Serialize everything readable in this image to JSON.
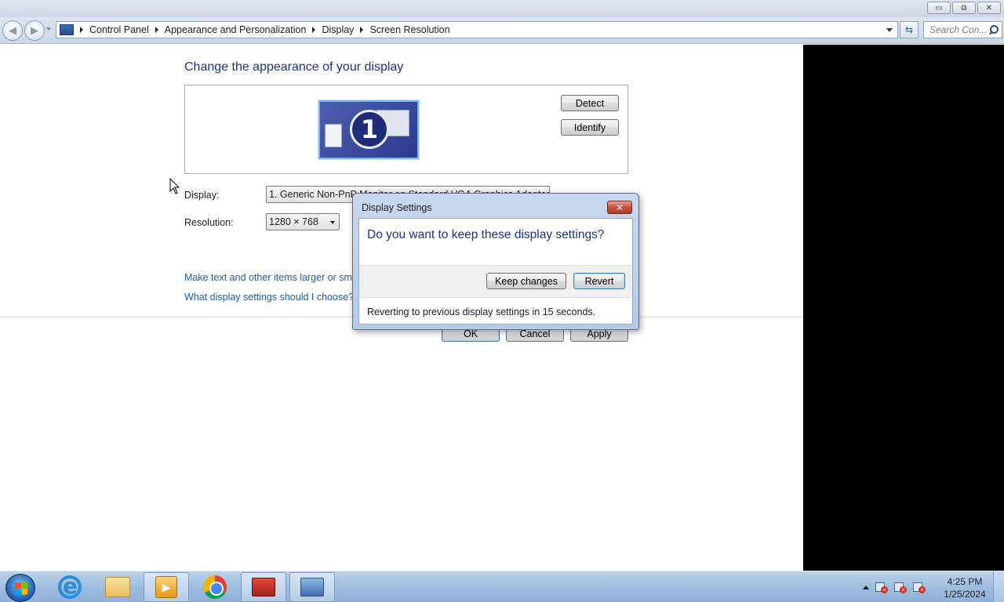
{
  "window": {
    "controls": {
      "minimize": "▭",
      "maximize": "⧉",
      "close": "✕"
    }
  },
  "address": {
    "breadcrumbs": [
      "Control Panel",
      "Appearance and Personalization",
      "Display",
      "Screen Resolution"
    ],
    "search_placeholder": "Search Con..."
  },
  "main": {
    "heading": "Change the appearance of your display",
    "monitor_number": "1",
    "detect_label": "Detect",
    "identify_label": "Identify",
    "display_label": "Display:",
    "display_value": "1. Generic Non-PnP Monitor on Standard VGA Graphics Adapter",
    "resolution_label": "Resolution:",
    "resolution_value": "1280 × 768",
    "link_larger_text": "Make text and other items larger or smaller",
    "link_what_settings": "What display settings should I choose?",
    "ok_label": "OK",
    "cancel_label": "Cancel",
    "apply_label": "Apply"
  },
  "dialog": {
    "title": "Display Settings",
    "close_glyph": "✕",
    "question": "Do you want to keep these display settings?",
    "keep_label": "Keep changes",
    "revert_label": "Revert",
    "footer": "Reverting to previous display settings in 15 seconds."
  },
  "taskbar": {
    "clock_time": "4:25 PM",
    "clock_date": "1/25/2024",
    "items": [
      "internet-explorer-icon",
      "folder-icon",
      "media-player-icon",
      "chrome-icon",
      "toolbox-icon",
      "display-settings-icon"
    ]
  },
  "colors": {
    "heading_blue": "#1e3287",
    "link_blue": "#1e5fa5",
    "taskbar": "#9fbedf"
  }
}
